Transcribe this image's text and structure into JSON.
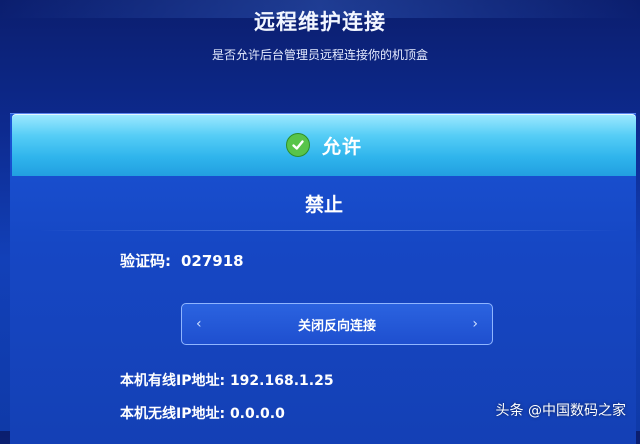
{
  "header": {
    "title": "远程维护连接",
    "subtitle": "是否允许后台管理员远程连接你的机顶盒"
  },
  "options": {
    "allow_label": "允许",
    "deny_label": "禁止"
  },
  "verification": {
    "label": "验证码:",
    "code": "027918"
  },
  "reverse_connection": {
    "label": "关闭反向连接",
    "left_arrow": "‹",
    "right_arrow": "›"
  },
  "network": {
    "wired": "本机有线IP地址: 192.168.1.25",
    "wireless": "本机无线IP地址: 0.0.0.0"
  },
  "watermark": "头条 @中国数码之家",
  "colors": {
    "background": "#0d2a8f",
    "selected_option": "#2fb4ec",
    "check_green": "#58c44a"
  }
}
